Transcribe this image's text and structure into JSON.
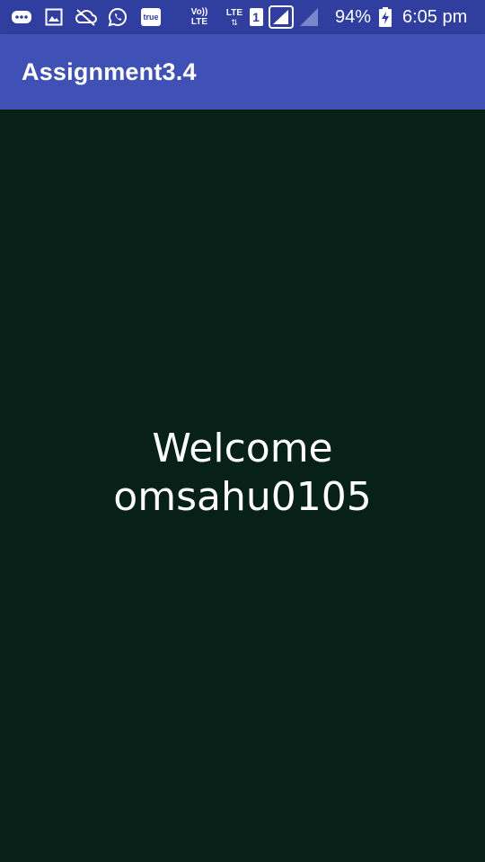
{
  "status_bar": {
    "icons": [
      "chat-bubble-icon",
      "gallery-icon",
      "cloud-off-icon",
      "whatsapp-icon",
      "true-app-icon",
      "volte-icon",
      "lte-data-icon",
      "sim1-icon",
      "signal-icon",
      "signal-sim2-icon",
      "battery-charging-icon"
    ],
    "volte_label": "Vo)) LTE",
    "lte_label": "LTE",
    "sim_label": "1",
    "true_label": "true",
    "battery_percent": "94%",
    "time": "6:05 pm"
  },
  "toolbar": {
    "title": "Assignment3.4"
  },
  "main": {
    "welcome_line1": "Welcome",
    "welcome_line2": "omsahu0105"
  },
  "colors": {
    "status_bar": "#303F9F",
    "toolbar": "#3F51B5",
    "background": "#072119",
    "text": "#FFFFFF"
  }
}
